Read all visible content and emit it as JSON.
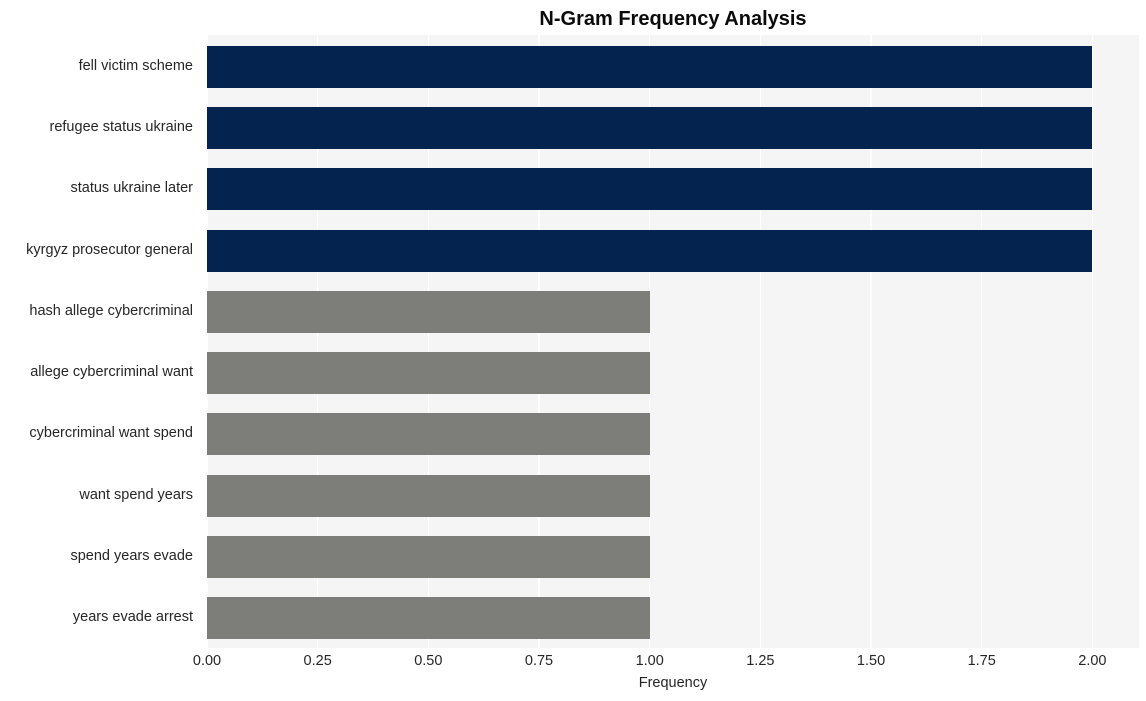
{
  "chart_data": {
    "type": "bar",
    "orientation": "horizontal",
    "title": "N-Gram Frequency Analysis",
    "xlabel": "Frequency",
    "ylabel": "",
    "categories": [
      "fell victim scheme",
      "refugee status ukraine",
      "status ukraine later",
      "kyrgyz prosecutor general",
      "hash allege cybercriminal",
      "allege cybercriminal want",
      "cybercriminal want spend",
      "want spend years",
      "spend years evade",
      "years evade arrest"
    ],
    "values": [
      2,
      2,
      2,
      2,
      1,
      1,
      1,
      1,
      1,
      1
    ],
    "bar_colors": [
      "#04234f",
      "#04234f",
      "#04234f",
      "#04234f",
      "#7d7d7a",
      "#7d7d7a",
      "#7d7d7a",
      "#7d7d7a",
      "#7d7d7a",
      "#7d7d7a"
    ],
    "xlim": [
      0,
      2.1053
    ],
    "xticks": [
      0,
      0.25,
      0.5,
      0.75,
      1,
      1.25,
      1.5,
      1.75,
      2
    ],
    "xtick_labels": [
      "0.00",
      "0.25",
      "0.50",
      "0.75",
      "1.00",
      "1.25",
      "1.50",
      "1.75",
      "2.00"
    ],
    "grid": true,
    "grid_axis": "x",
    "grid_color": "#ffffff",
    "plot_background": "#f5f5f5",
    "figure_background": "#ffffff",
    "legend": null,
    "colors": {
      "primary": "#04234f",
      "secondary": "#7d7d7a",
      "text": "#262626",
      "title": "#0a0a0a"
    }
  }
}
